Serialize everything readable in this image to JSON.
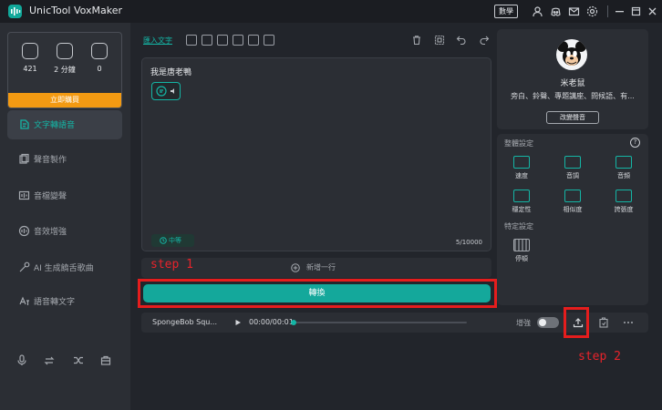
{
  "app": {
    "title": "UnicTool VoxMaker",
    "lang_button": "數學"
  },
  "sidebar": {
    "stats": [
      {
        "icon": "voice-count-icon",
        "value": "421"
      },
      {
        "icon": "minutes-icon",
        "value": "2 分鐘"
      },
      {
        "icon": "files-icon",
        "value": "0"
      }
    ],
    "unlock_label": "立即購買",
    "items": [
      {
        "label": "文字轉語音",
        "icon": "text-to-speech-icon",
        "active": true
      },
      {
        "label": "聲音製作",
        "icon": "voice-clone-icon"
      },
      {
        "label": "音檔變聲",
        "icon": "voice-changer-icon"
      },
      {
        "label": "音效增強",
        "icon": "audio-enhance-icon"
      },
      {
        "label": "AI 生成饒舌歌曲",
        "icon": "ai-rap-icon"
      },
      {
        "label": "語音轉文字",
        "icon": "speech-to-text-icon"
      }
    ]
  },
  "toolbar": {
    "import_label": "匯入文字"
  },
  "editor": {
    "text": "我是唐老鴨",
    "speed_label": "中等",
    "counter": "5/10000",
    "add_line_label": "新增一行"
  },
  "convert_label": "轉換",
  "annotations": {
    "step1": "step 1",
    "step2": "step 2"
  },
  "player": {
    "title": "SpongeBob Squ...",
    "time": "00:00/00:01",
    "progress": 0.0,
    "enhance_label": "增強"
  },
  "voice": {
    "name": "米老鼠",
    "tags": "旁白、鈴聲、專題講座、問候語、有...",
    "change_label": "改變聲音"
  },
  "settings": {
    "title": "整體設定",
    "items": [
      {
        "label": "速度",
        "icon": "speed-icon"
      },
      {
        "label": "音調",
        "icon": "pitch-icon"
      },
      {
        "label": "音頻",
        "icon": "volume-icon"
      },
      {
        "label": "穩定性",
        "icon": "stability-icon"
      },
      {
        "label": "相似度",
        "icon": "similarity-icon"
      },
      {
        "label": "誇張度",
        "icon": "exaggeration-icon"
      }
    ],
    "specific_title": "特定設定",
    "pause_label": "停頓"
  },
  "colors": {
    "accent": "#14b5a5",
    "unlock": "#f39a12",
    "annotation": "#e51d1d"
  }
}
